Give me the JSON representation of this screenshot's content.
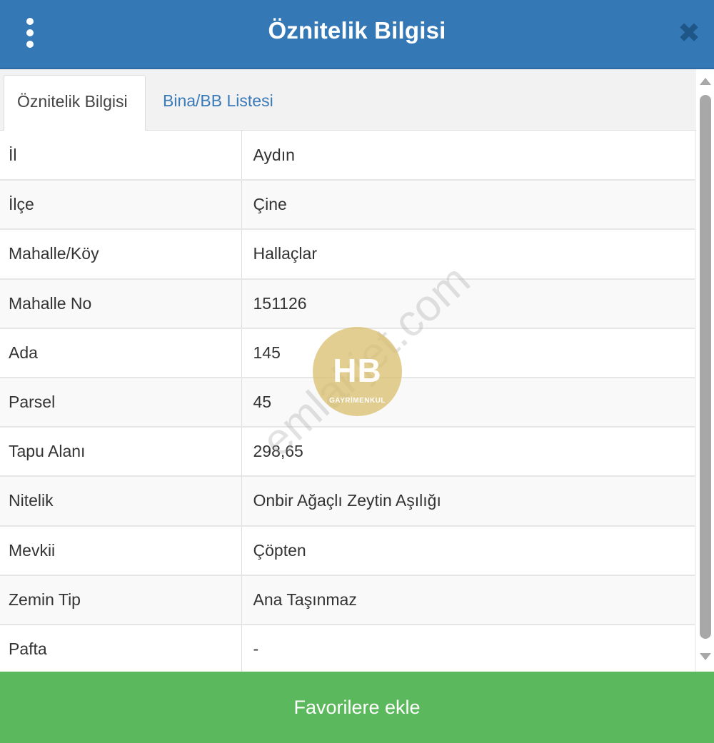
{
  "header": {
    "title": "Öznitelik Bilgisi",
    "close_label": "✖"
  },
  "tabs": [
    {
      "label": "Öznitelik Bilgisi",
      "active": true
    },
    {
      "label": "Bina/BB Listesi",
      "active": false
    }
  ],
  "attributes": [
    {
      "key": "İl",
      "value": "Aydın"
    },
    {
      "key": "İlçe",
      "value": "Çine"
    },
    {
      "key": "Mahalle/Köy",
      "value": "Hallaçlar"
    },
    {
      "key": "Mahalle No",
      "value": "151126"
    },
    {
      "key": "Ada",
      "value": "145"
    },
    {
      "key": "Parsel",
      "value": "45"
    },
    {
      "key": "Tapu Alanı",
      "value": "298,65"
    },
    {
      "key": "Nitelik",
      "value": "Onbir Ağaçlı Zeytin Aşılığı"
    },
    {
      "key": "Mevkii",
      "value": "Çöpten"
    },
    {
      "key": "Zemin Tip",
      "value": "Ana Taşınmaz"
    },
    {
      "key": "Pafta",
      "value": "-"
    }
  ],
  "footer": {
    "button_label": "Favorilere ekle"
  },
  "watermark": {
    "logo_text": "HB",
    "logo_subtext": "GAYRİMENKUL",
    "site_text": "emlakjet.com"
  },
  "colors": {
    "header_bg": "#3478b5",
    "tab_link": "#3a7ab8",
    "footer_bg": "#5cb85c"
  },
  "icons": {
    "menu": "vertical-dots-icon",
    "close": "close-icon",
    "scroll_up": "arrow-up-icon",
    "scroll_down": "arrow-down-icon"
  }
}
